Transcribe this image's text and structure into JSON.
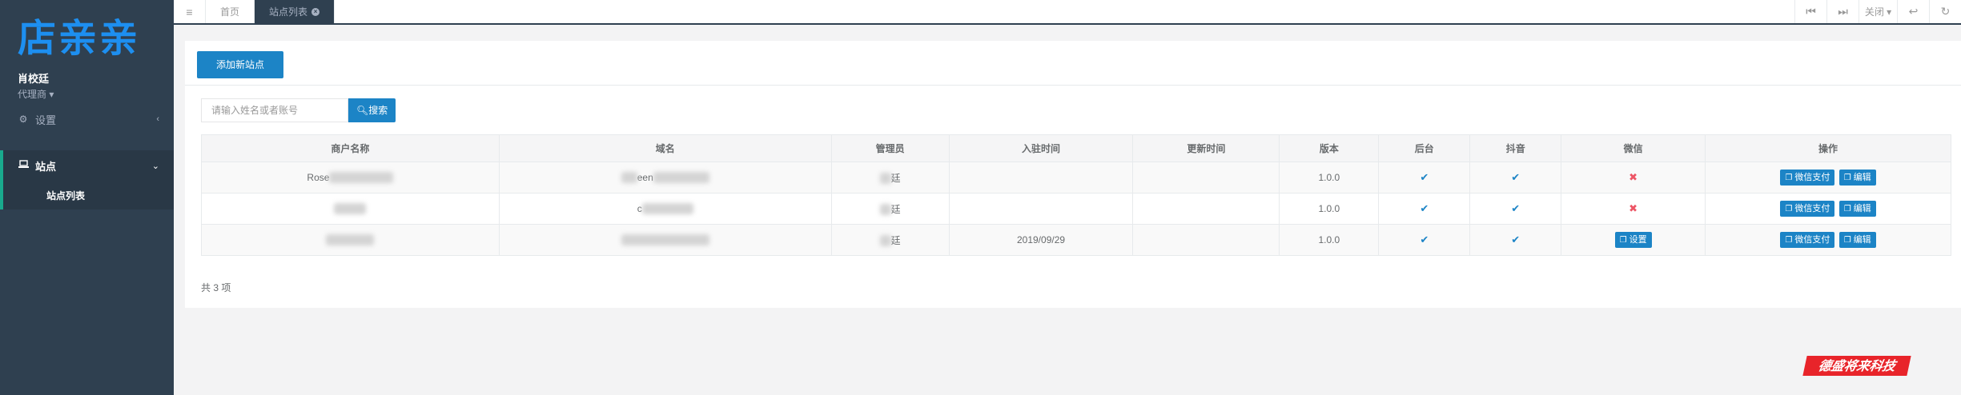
{
  "app": {
    "logo_text": "店亲亲"
  },
  "profile": {
    "name": "肖校廷",
    "role": "代理商 ▾"
  },
  "sidebar": {
    "items": [
      {
        "label": "设置",
        "icon": "gear-icon"
      },
      {
        "label": "站点",
        "icon": "laptop-icon"
      }
    ],
    "subitems": [
      {
        "label": "站点列表"
      }
    ]
  },
  "topbar": {
    "menu_icon": "≡",
    "tabs": [
      {
        "label": "首页"
      },
      {
        "label": "站点列表"
      }
    ],
    "close_label": "关闭 ▾"
  },
  "toolbar": {
    "add_label": "添加新站点"
  },
  "search": {
    "placeholder": "请输入姓名或者账号",
    "button_label": "搜索"
  },
  "table": {
    "columns": [
      "商户名称",
      "域名",
      "管理员",
      "入驻时间",
      "更新时间",
      "版本",
      "后台",
      "抖音",
      "微信",
      "操作"
    ],
    "rows": [
      {
        "merchant": "Rose",
        "domain": "een",
        "admin": "廷",
        "joined": "",
        "updated": "",
        "version": "1.0.0",
        "backend": "✔",
        "douyin": "✔",
        "wechat": "✖"
      },
      {
        "merchant": "",
        "domain": "c",
        "admin": "廷",
        "joined": "",
        "updated": "",
        "version": "1.0.0",
        "backend": "✔",
        "douyin": "✔",
        "wechat": "✖"
      },
      {
        "merchant": "",
        "domain": "",
        "admin": "廷",
        "joined": "2019/09/29",
        "updated": "",
        "version": "1.0.0",
        "backend": "✔",
        "douyin": "✔",
        "wechat": "设置"
      }
    ],
    "action_pay": "微信支付",
    "action_edit": "编辑"
  },
  "footer": {
    "count_text": "共 3 项"
  },
  "watermark": {
    "text": "德盛将来科技"
  },
  "colors": {
    "sidebar": "#2f4050",
    "primary": "#1c84c6",
    "logo": "#1d8ff0",
    "danger": "#ed5565"
  }
}
